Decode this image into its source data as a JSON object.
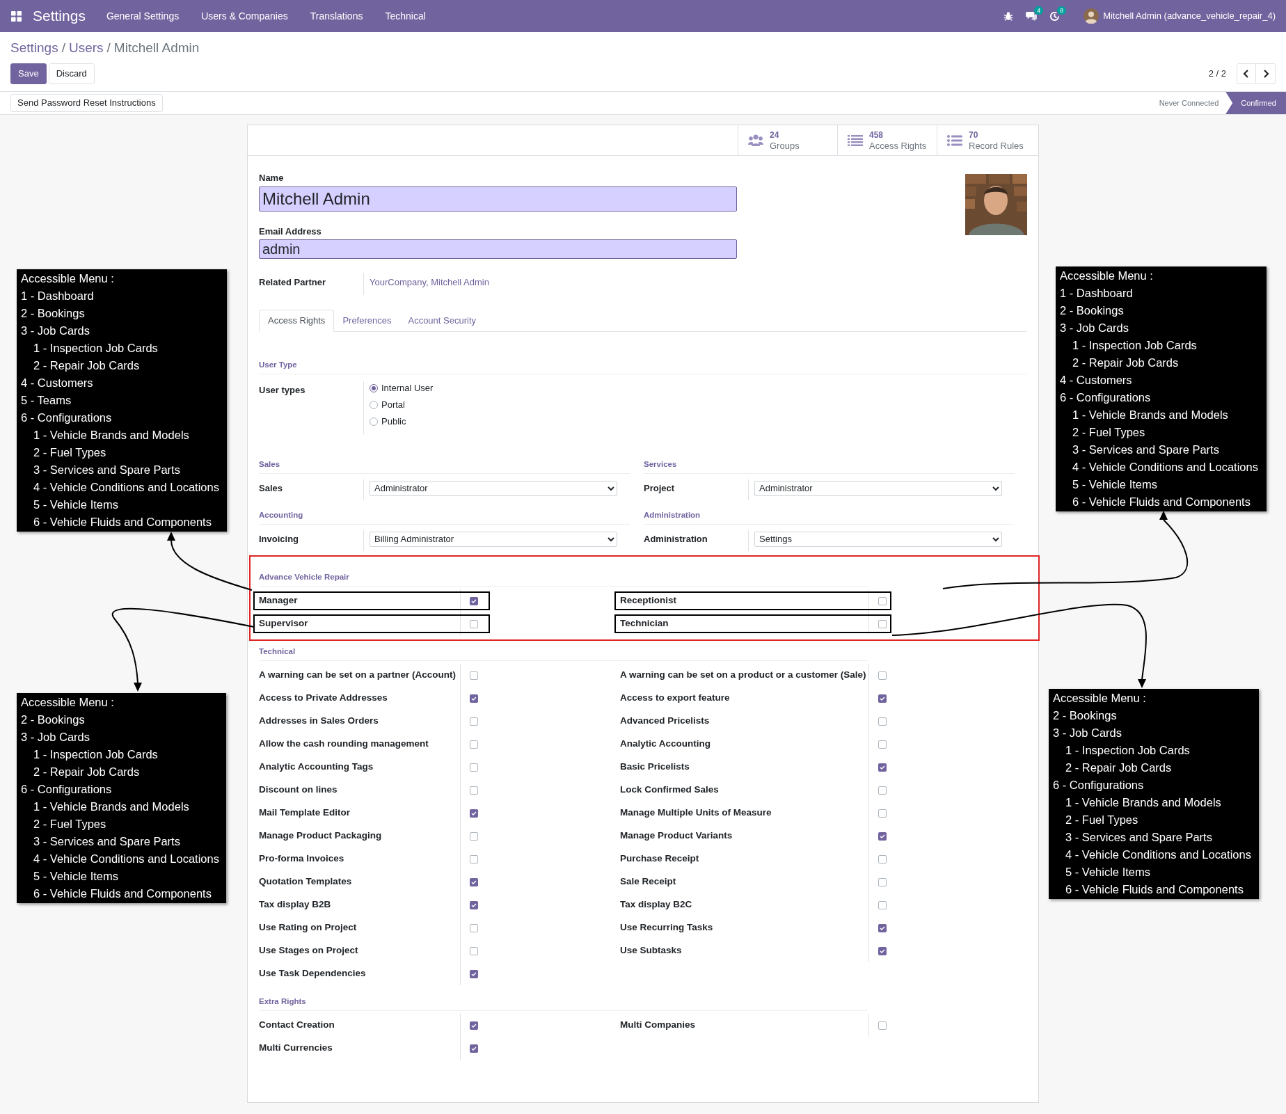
{
  "navbar": {
    "app": "Settings",
    "menu": [
      "General Settings",
      "Users & Companies",
      "Translations",
      "Technical"
    ],
    "messages_count": "4",
    "activities_count": "8",
    "user": "Mitchell Admin (advance_vehicle_repair_4)"
  },
  "breadcrumb": [
    {
      "label": "Settings"
    },
    {
      "separator": "/",
      "label": "Users"
    },
    {
      "separator": "/",
      "label": "Mitchell Admin"
    }
  ],
  "buttons": [
    "Save",
    "Discard"
  ],
  "pager": "2 / 2",
  "action_button": "Send Password Reset Instructions",
  "status": [
    {
      "label": "Never Connected",
      "selected": false
    },
    {
      "label": "Confirmed",
      "selected": true
    }
  ],
  "stats": [
    {
      "value": "24",
      "label": "Groups"
    },
    {
      "value": "458",
      "label": "Access Rights"
    },
    {
      "value": "70",
      "label": "Record Rules"
    }
  ],
  "name": {
    "label": "Name",
    "value": "Mitchell Admin"
  },
  "email": {
    "label": "Email Address",
    "value": "admin"
  },
  "related_partner": {
    "label": "Related Partner",
    "value": "YourCompany, Mitchell Admin"
  },
  "tabs": [
    {
      "label": "Access Rights",
      "selected": true
    },
    {
      "label": "Preferences",
      "selected": false
    },
    {
      "label": "Account Security",
      "selected": false
    }
  ],
  "user_type": {
    "heading": "User Type",
    "label": "User types",
    "options": [
      {
        "label": "Internal User",
        "selected": true
      },
      {
        "label": "Portal",
        "selected": false
      },
      {
        "label": "Public",
        "selected": false
      }
    ]
  },
  "select_groups": [
    {
      "heading": "Sales",
      "label": "Sales",
      "value": "Administrator"
    },
    {
      "heading": "Services",
      "label": "Project",
      "value": "Administrator"
    },
    {
      "heading": "Accounting",
      "label": "Invoicing",
      "value": "Billing Administrator"
    },
    {
      "heading": "Administration",
      "label": "Administration",
      "value": "Settings"
    }
  ],
  "checkbox_sections": [
    {
      "heading": "Advance Vehicle Repair",
      "highlighted": true,
      "left": [
        {
          "label": "Manager",
          "checked": true,
          "boxed": true
        },
        {
          "label": "Supervisor",
          "checked": false,
          "boxed": true
        }
      ],
      "right": [
        {
          "label": "Receptionist",
          "checked": false,
          "boxed": true
        },
        {
          "label": "Technician",
          "checked": false,
          "boxed": true
        }
      ]
    },
    {
      "heading": "Technical",
      "highlighted": false,
      "left": [
        {
          "label": "A warning can be set on a partner (Account)",
          "checked": false,
          "boxed": false
        },
        {
          "label": "Access to Private Addresses",
          "checked": true,
          "boxed": false
        },
        {
          "label": "Addresses in Sales Orders",
          "checked": false,
          "boxed": false
        },
        {
          "label": "Allow the cash rounding management",
          "checked": false,
          "boxed": false
        },
        {
          "label": "Analytic Accounting Tags",
          "checked": false,
          "boxed": false
        },
        {
          "label": "Discount on lines",
          "checked": false,
          "boxed": false
        },
        {
          "label": "Mail Template Editor",
          "checked": true,
          "boxed": false
        },
        {
          "label": "Manage Product Packaging",
          "checked": false,
          "boxed": false
        },
        {
          "label": "Pro-forma Invoices",
          "checked": false,
          "boxed": false
        },
        {
          "label": "Quotation Templates",
          "checked": true,
          "boxed": false
        },
        {
          "label": "Tax display B2B",
          "checked": true,
          "boxed": false
        },
        {
          "label": "Use Rating on Project",
          "checked": false,
          "boxed": false
        },
        {
          "label": "Use Stages on Project",
          "checked": false,
          "boxed": false
        },
        {
          "label": "Use Task Dependencies",
          "checked": true,
          "boxed": false
        }
      ],
      "right": [
        {
          "label": "A warning can be set on a product or a customer (Sale)",
          "checked": false,
          "boxed": false
        },
        {
          "label": "Access to export feature",
          "checked": true,
          "boxed": false
        },
        {
          "label": "Advanced Pricelists",
          "checked": false,
          "boxed": false
        },
        {
          "label": "Analytic Accounting",
          "checked": false,
          "boxed": false
        },
        {
          "label": "Basic Pricelists",
          "checked": true,
          "boxed": false
        },
        {
          "label": "Lock Confirmed Sales",
          "checked": false,
          "boxed": false
        },
        {
          "label": "Manage Multiple Units of Measure",
          "checked": false,
          "boxed": false
        },
        {
          "label": "Manage Product Variants",
          "checked": true,
          "boxed": false
        },
        {
          "label": "Purchase Receipt",
          "checked": false,
          "boxed": false
        },
        {
          "label": "Sale Receipt",
          "checked": false,
          "boxed": false
        },
        {
          "label": "Tax display B2C",
          "checked": false,
          "boxed": false
        },
        {
          "label": "Use Recurring Tasks",
          "checked": true,
          "boxed": false
        },
        {
          "label": "Use Subtasks",
          "checked": true,
          "boxed": false
        }
      ]
    },
    {
      "heading": "Extra Rights",
      "highlighted": false,
      "left": [
        {
          "label": "Contact Creation",
          "checked": true,
          "boxed": false
        },
        {
          "label": "Multi Currencies",
          "checked": true,
          "boxed": false
        }
      ],
      "right": [
        {
          "label": "Multi Companies",
          "checked": false,
          "boxed": false
        }
      ]
    }
  ],
  "annotations": [
    {
      "title": "Accessible Menu :",
      "items": [
        {
          "label": "1 - Dashboard"
        },
        {
          "label": "2 - Bookings"
        },
        {
          "label": "3 - Job Cards",
          "children": [
            {
              "label": "1 - Inspection Job Cards"
            },
            {
              "label": "2 - Repair Job Cards"
            }
          ]
        },
        {
          "label": "4 - Customers"
        },
        {
          "label": "5 - Teams"
        },
        {
          "label": "6 - Configurations",
          "children": [
            {
              "label": "1 - Vehicle Brands and Models"
            },
            {
              "label": "2 - Fuel Types"
            },
            {
              "label": "3 - Services and Spare Parts"
            },
            {
              "label": "4 - Vehicle Conditions and Locations"
            },
            {
              "label": "5 - Vehicle Items"
            },
            {
              "label": "6 - Vehicle Fluids and Components"
            }
          ]
        }
      ]
    },
    {
      "title": "Accessible Menu :",
      "items": [
        {
          "label": "1 - Dashboard"
        },
        {
          "label": "2 - Bookings"
        },
        {
          "label": "3 - Job Cards",
          "children": [
            {
              "label": "1 - Inspection Job Cards"
            },
            {
              "label": "2 - Repair Job Cards"
            }
          ]
        },
        {
          "label": "4 - Customers"
        },
        {
          "label": "6 - Configurations",
          "children": [
            {
              "label": "1 - Vehicle Brands and Models"
            },
            {
              "label": "2 - Fuel Types"
            },
            {
              "label": "3 - Services and Spare Parts"
            },
            {
              "label": "4 - Vehicle Conditions and Locations"
            },
            {
              "label": "5 - Vehicle Items"
            },
            {
              "label": "6 - Vehicle Fluids and Components"
            }
          ]
        }
      ]
    },
    {
      "title": "Accessible Menu :",
      "items": [
        {
          "label": "2 - Bookings"
        },
        {
          "label": "3 - Job Cards",
          "children": [
            {
              "label": "1 - Inspection Job Cards"
            },
            {
              "label": "2 - Repair Job Cards"
            }
          ]
        },
        {
          "label": "6 - Configurations",
          "children": [
            {
              "label": "1 - Vehicle Brands and Models"
            },
            {
              "label": "2 - Fuel Types"
            },
            {
              "label": "3 - Services and Spare Parts"
            },
            {
              "label": "4 - Vehicle Conditions and Locations"
            },
            {
              "label": "5 - Vehicle Items"
            },
            {
              "label": "6 - Vehicle Fluids and Components"
            }
          ]
        }
      ]
    },
    {
      "title": "Accessible Menu :",
      "items": [
        {
          "label": "2 - Bookings"
        },
        {
          "label": "3 - Job Cards",
          "children": [
            {
              "label": "1 - Inspection Job Cards"
            },
            {
              "label": "2 - Repair Job Cards"
            }
          ]
        },
        {
          "label": "6 - Configurations",
          "children": [
            {
              "label": "1 - Vehicle Brands and Models"
            },
            {
              "label": "2 - Fuel Types"
            },
            {
              "label": "3 - Services and Spare Parts"
            },
            {
              "label": "4 - Vehicle Conditions and Locations"
            },
            {
              "label": "5 - Vehicle Items"
            },
            {
              "label": "6 - Vehicle Fluids and Components"
            }
          ]
        }
      ]
    }
  ]
}
